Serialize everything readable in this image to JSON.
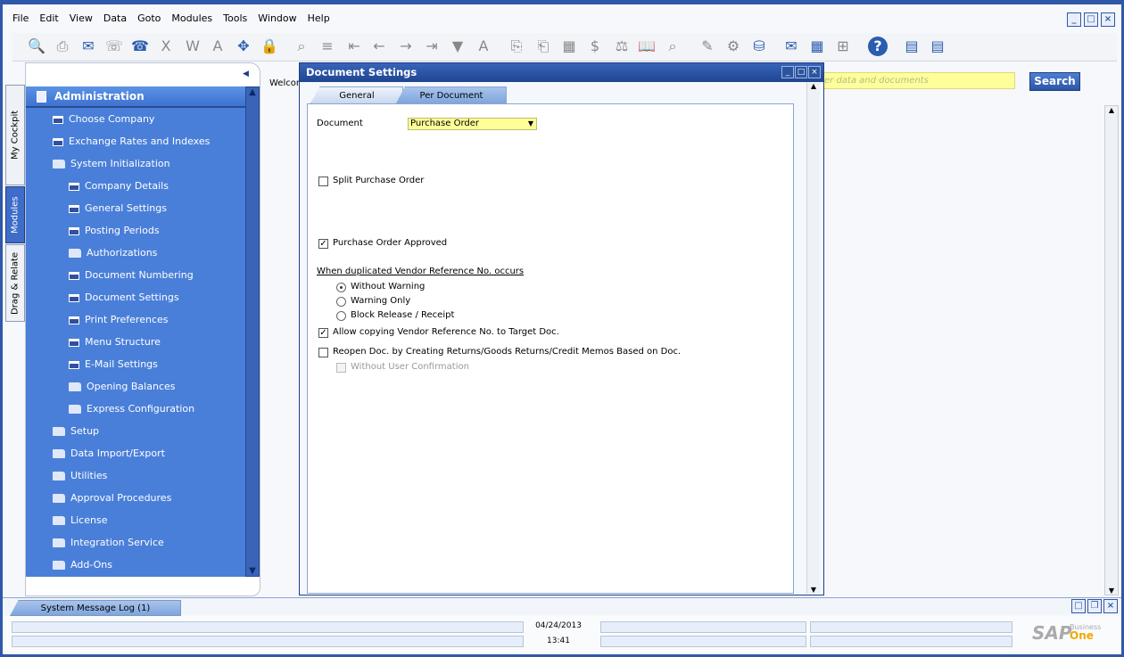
{
  "menu": [
    "File",
    "Edit",
    "View",
    "Data",
    "Goto",
    "Modules",
    "Tools",
    "Window",
    "Help"
  ],
  "toolbar_icons": [
    "print-preview-icon",
    "print-icon",
    "send-receive-icon",
    "sms-icon",
    "fax-icon",
    "excel-icon",
    "word-icon",
    "pdf-icon",
    "move-icon",
    "form-settings-lock-icon",
    "find-icon",
    "add-icon",
    "first-record-icon",
    "previous-record-icon",
    "next-record-icon",
    "last-record-icon",
    "filter-icon",
    "sort-icon",
    "base-document-icon",
    "target-document-icon",
    "calculator-icon",
    "gross-profit-icon",
    "balance-icon",
    "journal-icon",
    "transaction-journal-icon",
    "edit-icon",
    "settings-icon",
    "database-icon",
    "messages-alert-icon",
    "calendar-icon",
    "org-chart-icon",
    "help-icon",
    "report-icon",
    "query-icon"
  ],
  "vertical_tabs": [
    "My Cockpit",
    "Modules",
    "Drag & Relate"
  ],
  "sidebar": {
    "header": "Administration",
    "items": [
      {
        "label": "Choose Company",
        "icon": "form",
        "level": 0
      },
      {
        "label": "Exchange Rates and Indexes",
        "icon": "form",
        "level": 0
      },
      {
        "label": "System Initialization",
        "icon": "open-folder",
        "level": 0
      },
      {
        "label": "Company Details",
        "icon": "form",
        "level": 1
      },
      {
        "label": "General Settings",
        "icon": "form",
        "level": 1
      },
      {
        "label": "Posting Periods",
        "icon": "form",
        "level": 1
      },
      {
        "label": "Authorizations",
        "icon": "folder",
        "level": 1
      },
      {
        "label": "Document Numbering",
        "icon": "form",
        "level": 1
      },
      {
        "label": "Document Settings",
        "icon": "form",
        "level": 1
      },
      {
        "label": "Print Preferences",
        "icon": "form",
        "level": 1
      },
      {
        "label": "Menu Structure",
        "icon": "form",
        "level": 1
      },
      {
        "label": "E-Mail Settings",
        "icon": "form",
        "level": 1
      },
      {
        "label": "Opening Balances",
        "icon": "folder",
        "level": 1
      },
      {
        "label": "Express Configuration",
        "icon": "folder",
        "level": 1
      },
      {
        "label": "Setup",
        "icon": "folder",
        "level": 0
      },
      {
        "label": "Data Import/Export",
        "icon": "folder",
        "level": 0
      },
      {
        "label": "Utilities",
        "icon": "folder",
        "level": 0
      },
      {
        "label": "Approval Procedures",
        "icon": "folder",
        "level": 0
      },
      {
        "label": "License",
        "icon": "folder",
        "level": 0
      },
      {
        "label": "Integration Service",
        "icon": "folder",
        "level": 0
      },
      {
        "label": "Add-Ons",
        "icon": "folder",
        "level": 0
      }
    ]
  },
  "welcome": "Welcom",
  "search": {
    "placeholder": "er data and documents",
    "button": "Search"
  },
  "dialog": {
    "title": "Document Settings",
    "tabs": [
      "General",
      "Per Document"
    ],
    "active_tab": "Per Document",
    "document_label": "Document",
    "document_value": "Purchase Order",
    "split_label": "Split Purchase Order",
    "split_checked": false,
    "approved_label": "Purchase Order Approved",
    "approved_checked": true,
    "dup_heading": "When duplicated Vendor Reference No. occurs",
    "radios": [
      {
        "label": "Without Warning",
        "selected": true
      },
      {
        "label": "Warning Only",
        "selected": false
      },
      {
        "label": "Block Release / Receipt",
        "selected": false
      }
    ],
    "allow_copy_label": "Allow copying Vendor Reference No. to Target Doc.",
    "allow_copy_checked": true,
    "reopen_label": "Reopen Doc. by Creating Returns/Goods Returns/Credit Memos Based on Doc.",
    "reopen_checked": false,
    "confirm_label": "Without User Confirmation",
    "confirm_checked": false
  },
  "bottom": {
    "message_tab": "System Message Log (1)",
    "date": "04/24/2013",
    "time": "13:41",
    "logo_main": "SAP",
    "logo_top": "Business",
    "logo_bottom": "One"
  }
}
